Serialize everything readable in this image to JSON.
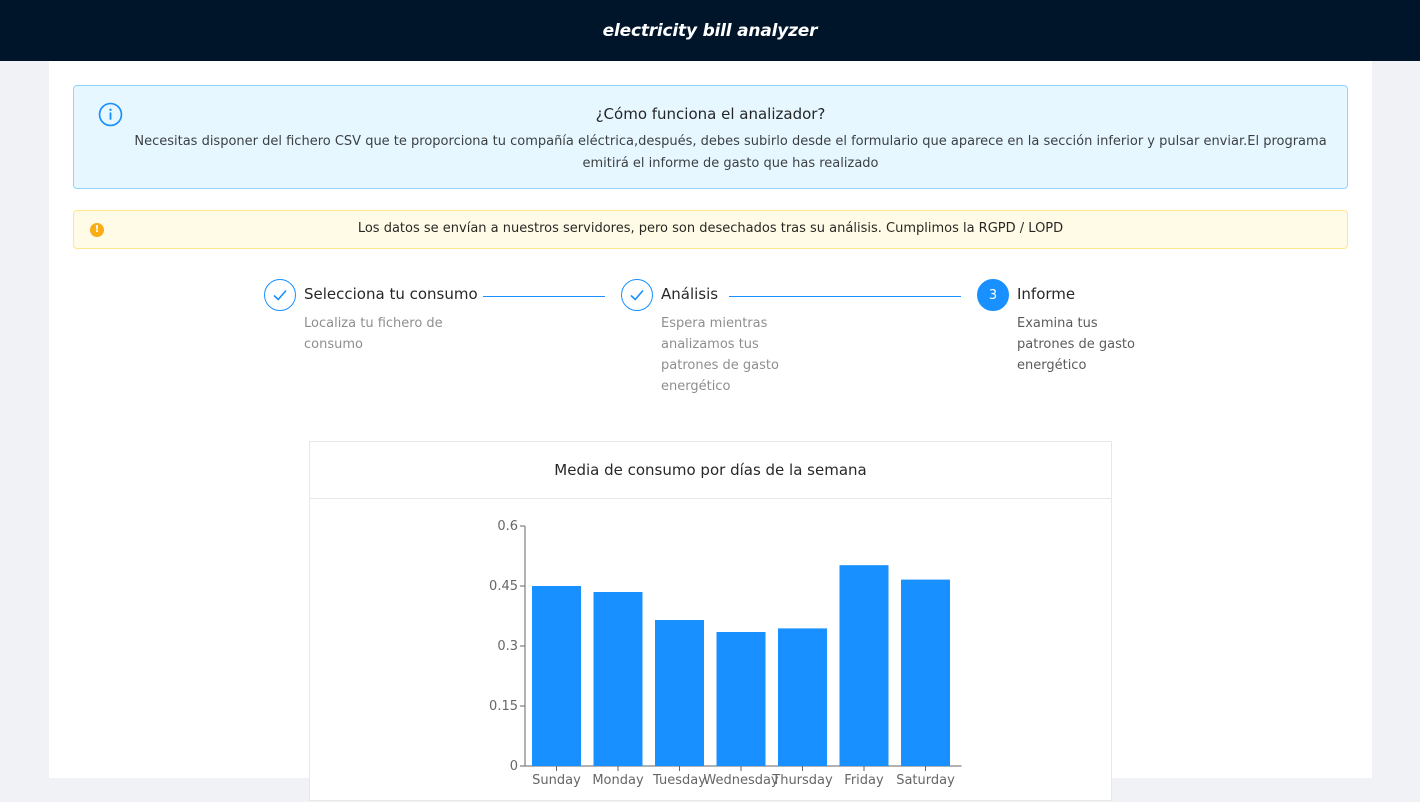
{
  "header": {
    "title": "electricity bill analyzer"
  },
  "info_alert": {
    "icon": "info-circle-icon",
    "title": "¿Cómo funciona el analizador?",
    "description": "Necesitas disponer del fichero CSV que te proporciona tu compañía eléctrica,después, debes subirlo desde el formulario que aparece en la sección inferior y pulsar enviar.El programa emitirá el informe de gasto que has realizado"
  },
  "warning_alert": {
    "icon": "exclamation-circle-icon",
    "icon_glyph": "!",
    "text": "Los datos se envían a nuestros servidores, pero son desechados tras su análisis. Cumplimos la RGPD / LOPD"
  },
  "steps": [
    {
      "status": "finished",
      "icon": "check-icon",
      "title": "Selecciona tu consumo",
      "description": "Localiza tu fichero de consumo"
    },
    {
      "status": "finished",
      "icon": "check-icon",
      "title": "Análisis",
      "description": "Espera mientras analizamos tus patrones de gasto energético"
    },
    {
      "status": "current",
      "number": "3",
      "title": "Informe",
      "description": "Examina tus patrones de gasto energético"
    }
  ],
  "chart_card": {
    "title": "Media de consumo por días de la semana"
  },
  "chart_data": {
    "type": "bar",
    "categories": [
      "Sunday",
      "Monday",
      "Tuesday",
      "Wednesday",
      "Thursday",
      "Friday",
      "Saturday"
    ],
    "values": [
      0.45,
      0.435,
      0.365,
      0.335,
      0.344,
      0.502,
      0.466
    ],
    "ylim": [
      0,
      0.6
    ],
    "yticks": [
      "0",
      "0.15",
      "0.3",
      "0.45",
      "0.6"
    ],
    "bar_color": "#1890ff",
    "grid": false
  },
  "colors": {
    "primary": "#1890ff",
    "header_bg": "#001529",
    "info_bg": "#e6f7ff",
    "warning_bg": "#fffbe6",
    "warning_icon": "#faad14"
  }
}
